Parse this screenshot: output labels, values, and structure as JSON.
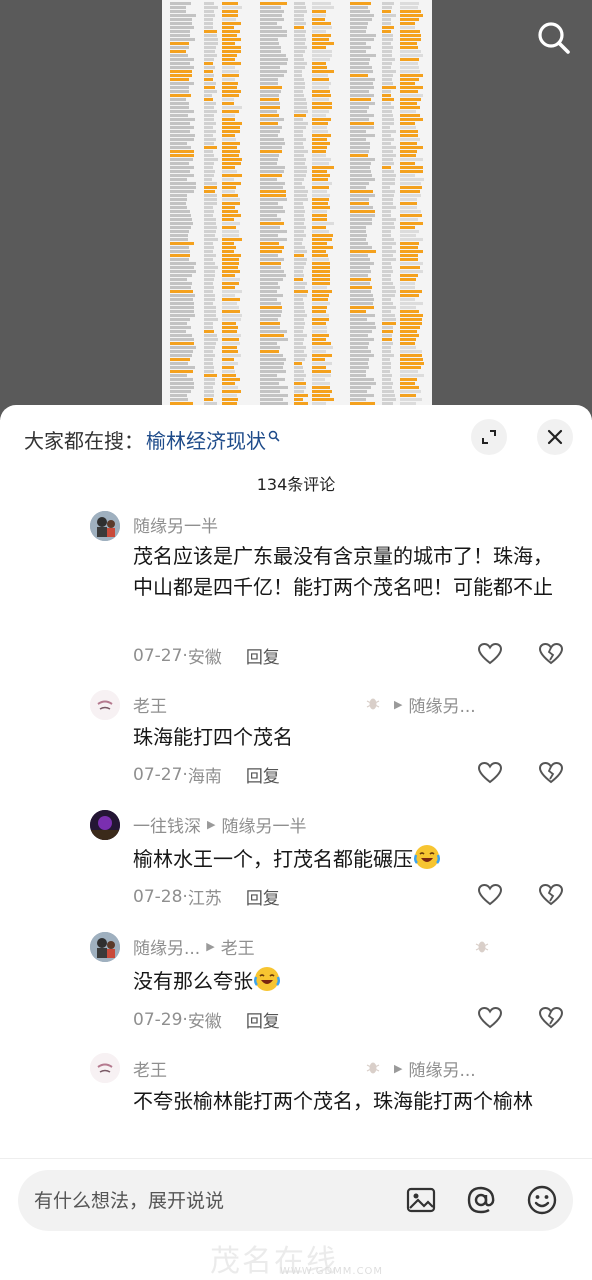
{
  "top_image": {
    "search_icon": "search-icon"
  },
  "panel": {
    "suggest_prefix": "大家都在搜：",
    "suggest_keyword": "榆林经济现状",
    "expand_icon": "expand-icon",
    "close_icon": "close-icon",
    "comment_count": "134条评论"
  },
  "comments": [
    {
      "user": "随缘另一半",
      "reply_to": "",
      "text": "茂名应该是广东最没有含京量的城市了！珠海，中山都是四千亿！能打两个茂名吧！可能都不止",
      "date": "07-27",
      "sep": "·",
      "location": "安徽",
      "reply_label": "回复"
    },
    {
      "user": "老王",
      "reply_to": "随缘另...",
      "text": "珠海能打四个茂名",
      "date": "07-27",
      "sep": "·",
      "location": "海南",
      "reply_label": "回复"
    },
    {
      "user": "一往钱深",
      "reply_to": "随缘另一半",
      "text": "榆林水王一个，打茂名都能碾压",
      "date": "07-28",
      "sep": "·",
      "location": "江苏",
      "reply_label": "回复"
    },
    {
      "user": "随缘另...",
      "reply_to": "老王",
      "text": "没有那么夸张",
      "date": "07-29",
      "sep": "·",
      "location": "安徽",
      "reply_label": "回复"
    },
    {
      "user": "老王",
      "reply_to": "随缘另...",
      "text": "不夸张榆林能打两个茂名，珠海能打两个榆林"
    }
  ],
  "input": {
    "placeholder": "有什么想法，展开说说",
    "image_icon": "image-icon",
    "mention_icon": "at-mention-icon",
    "emoji_icon": "smile-emoji-icon"
  },
  "watermark": {
    "text_big": "茂名在线",
    "text_small": "WWW.GDMM.COM"
  },
  "colors": {
    "keyword": "#1e4b8a",
    "sheet_highlight": "#f39c12",
    "muted": "#8f8f8f"
  }
}
